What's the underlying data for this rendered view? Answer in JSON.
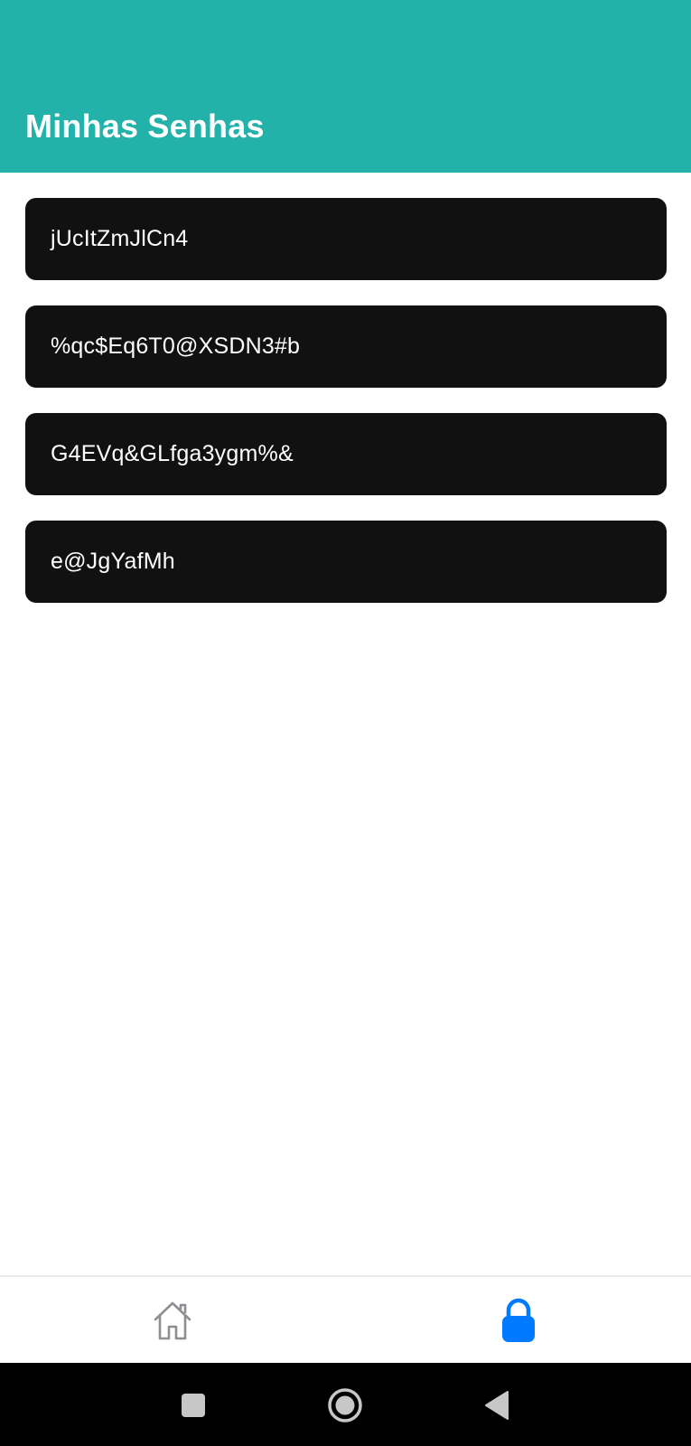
{
  "header": {
    "title": "Minhas Senhas",
    "background_color": "#22b2aa"
  },
  "passwords": [
    {
      "value": "jUcItZmJlCn4"
    },
    {
      "value": "%qc$Eq6T0@XSDN3#b"
    },
    {
      "value": "G4EVq&GLfga3ygm%&"
    },
    {
      "value": "e@JgYafMh"
    }
  ],
  "tab_bar": {
    "tabs": [
      {
        "icon": "home-icon",
        "active": false,
        "color": "#8e8e93"
      },
      {
        "icon": "lock-icon",
        "active": true,
        "color": "#007aff"
      }
    ]
  },
  "system_nav": {
    "buttons": [
      "recents-icon",
      "home-circle-icon",
      "back-triangle-icon"
    ]
  }
}
